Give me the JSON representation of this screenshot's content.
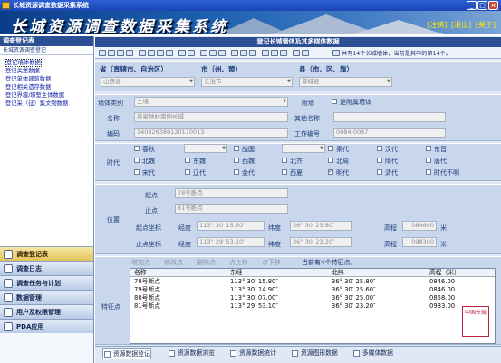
{
  "window": {
    "title": "长城资源调查数据采集系统",
    "min": "_",
    "max": "□",
    "close": "×"
  },
  "banner": {
    "title": "长城资源调查数据采集系统",
    "links": [
      "[注销]",
      "[退出]",
      "[关于]"
    ]
  },
  "sidebar": {
    "header": "调查登记表",
    "subheader": "长城资源调查登记",
    "items": [
      "登记墙体数据",
      "登记关堡数据",
      "登记单体建筑数据",
      "登记相关遗存数据",
      "登记界壕/壕堑主体数据",
      "登记采（征）集文物数据"
    ],
    "nav": [
      "调查登记表",
      "调查日志",
      "调查任务与计划",
      "数据管理",
      "用户及权限管理",
      "PDA应用"
    ]
  },
  "form": {
    "title": "登记长城墙体及其多媒体数据",
    "record_info": "共有14个长城墙体，当前是其中的第14个。",
    "province_label": "省（直辖市、自治区）",
    "city_label": "市（州、盟）",
    "county_label": "县（市、区、旗）",
    "province": "山西省",
    "city": "长治市",
    "county": "黎城县",
    "type_label": "墙体类别",
    "type": "土墙",
    "attached_label": "附墙",
    "attached_check": "是附属墙体",
    "name_label": "名称",
    "name": "孙家地村南侧长城",
    "other_name_label": "其他名称",
    "other_name": "",
    "code_label": "编码",
    "code": "140426380120170013",
    "work_code_label": "工作编号",
    "work_code": "0084-0087",
    "era_label": "时代",
    "eras_row1": [
      "春秋",
      "",
      "战国",
      "",
      "秦代",
      "汉代",
      "东晋"
    ],
    "eras_row2": [
      "北魏",
      "东魏",
      "西魏",
      "北齐",
      "北周",
      "隋代",
      "唐代"
    ],
    "eras_row3": [
      "宋代",
      "辽代",
      "金代",
      "西夏",
      "明代",
      "清代",
      "时代不明"
    ],
    "eras_checked": [
      "明代"
    ],
    "location_label": "位置",
    "start_label": "起点",
    "start": "78号断点",
    "end_label": "止点",
    "end": "81号断点",
    "start_coord_label": "起点坐标",
    "end_coord_label": "止点坐标",
    "lon_label": "经度",
    "lat_label": "纬度",
    "alt_label": "高程",
    "unit": "米",
    "start_lon": "113° 30′ 15.80″",
    "start_lat": "36° 30′ 25.80″",
    "start_alt": "084600",
    "end_lon": "113° 29′ 53.10″",
    "end_lat": "36° 30′ 23.20″",
    "end_alt": "098300",
    "points_label": "特征点",
    "pt_toolbar": [
      "增加点",
      "修改点",
      "删除点",
      "点上移",
      "点下移"
    ],
    "pt_current": "当前有4个特征点。",
    "pt_columns": [
      "名称",
      "东经",
      "北纬",
      "高程（米）"
    ],
    "pt_rows": [
      [
        "78号断点",
        "113° 30′ 15.80″",
        "36° 30′ 25.80″",
        "0846.00"
      ],
      [
        "79号断点",
        "113° 30′ 14.90″",
        "36° 30′ 25.60″",
        "0846.00"
      ],
      [
        "80号断点",
        "113° 30′ 07.00″",
        "36° 30′ 25.00″",
        "0858.00"
      ],
      [
        "81号断点",
        "113° 29′ 53.10″",
        "36° 30′ 23.20″",
        "0983.00"
      ]
    ]
  },
  "tabs": [
    "资源数据登记",
    "资源数据浏览",
    "资源数据统计",
    "资源图形数据",
    "多媒体数据"
  ],
  "stamp": "中国长城"
}
